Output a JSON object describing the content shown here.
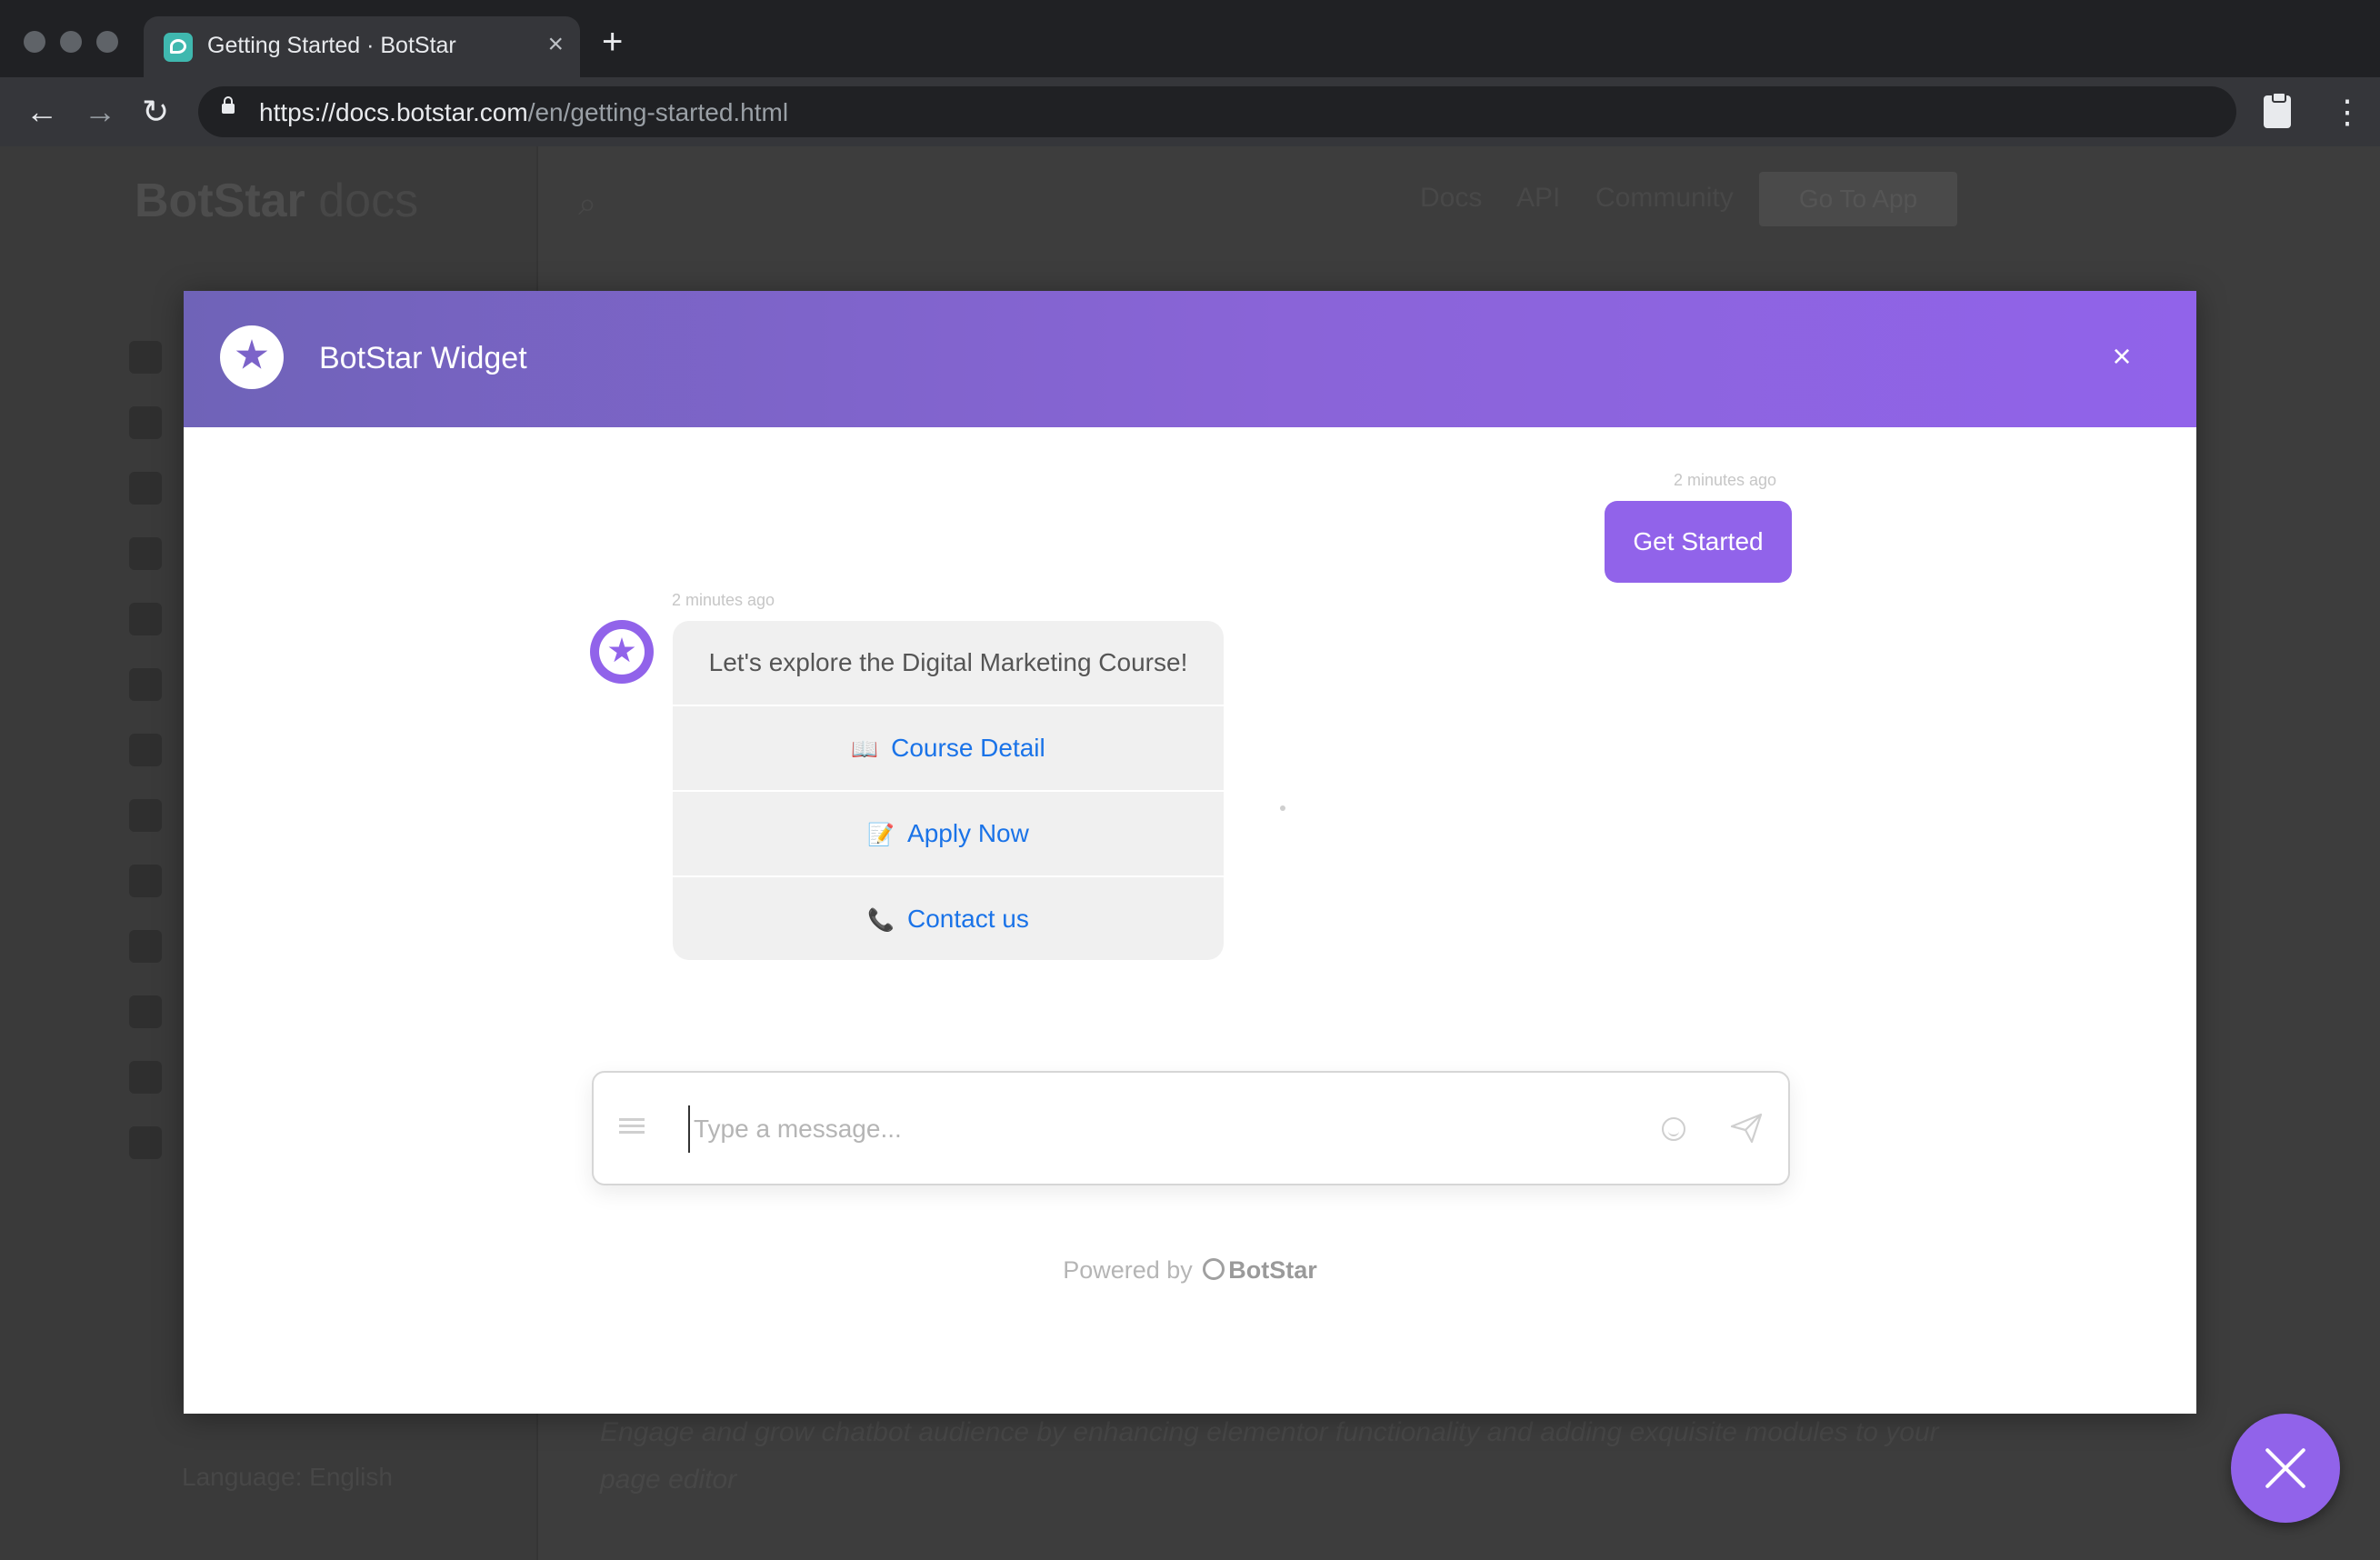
{
  "browser": {
    "tab_title": "Getting Started · BotStar",
    "tab_close": "×",
    "new_tab": "+",
    "url_host": "https://docs.botstar.com",
    "url_path": "/en/getting-started.html",
    "back": "←",
    "forward": "→",
    "reload": "↻",
    "menu": "⋮"
  },
  "background_page": {
    "logo_main": "BotStar",
    "logo_docs": "docs",
    "search_glyph": "⌕",
    "nav": [
      "Docs",
      "API",
      "Community"
    ],
    "go_to_app": "Go To App",
    "text_line_1": "Engage and grow chatbot audience by enhancing elementor functionality and adding exquisite modules to your",
    "text_line_2": "page editor",
    "language": "Language: English"
  },
  "widget": {
    "title": "BotStar Widget",
    "close": "×",
    "user_message": {
      "timestamp": "2 minutes ago",
      "text": "Get Started"
    },
    "bot_message": {
      "timestamp": "2 minutes ago",
      "text": "Let's explore the Digital Marketing Course!",
      "buttons": [
        {
          "emoji": "📖",
          "label": "Course Detail"
        },
        {
          "emoji": "📝",
          "label": "Apply Now"
        },
        {
          "emoji": "📞",
          "label": "Contact us"
        }
      ]
    },
    "input": {
      "placeholder": "Type a message..."
    },
    "powered_by": "Powered by",
    "powered_brand": "BotStar"
  },
  "colors": {
    "accent": "#9163ea",
    "header_start": "#6f63b8",
    "link": "#1a73e8"
  }
}
